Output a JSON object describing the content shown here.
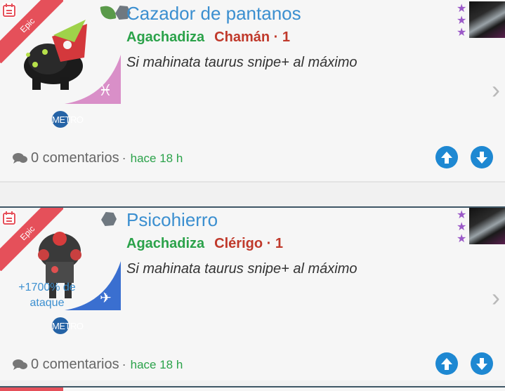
{
  "cards": [
    {
      "rarity": "Epic",
      "name": "Cazador de pantanos",
      "family": "Agachadiza",
      "role": "Chamán · 1",
      "description": "Si mahinata taurus snipe+ al máximo",
      "tribe_symbol": "♓",
      "bonus_line1": "",
      "bonus_line2": "",
      "metro_label": "METRO",
      "stars": [
        "★",
        "★",
        "★"
      ],
      "comments": "0 comentarios",
      "separator": "·",
      "time": "hace 18 h",
      "triangle_color": "#d98fc8"
    },
    {
      "rarity": "Epic",
      "name": "Psicohierro",
      "family": "Agachadiza",
      "role": "Clérigo · 1",
      "description": "Si mahinata taurus snipe+ al máximo",
      "tribe_symbol": "✈",
      "bonus_line1": "+1700% de",
      "bonus_line2": "ataque",
      "metro_label": "METRO",
      "stars": [
        "★",
        "★",
        "★"
      ],
      "comments": "0 comentarios",
      "separator": "·",
      "time": "hace 18 h",
      "triangle_color": "#3a6fd0"
    }
  ],
  "colors": {
    "title": "#3b8fd0",
    "family": "#2ba24a",
    "role": "#c0392b",
    "ribbon": "#e5505a",
    "vote": "#1e88d2",
    "stars": "#9b59c8"
  },
  "icons": {
    "calendar": "calendar-icon",
    "chevron": "chevron-right-icon",
    "upvote": "arrow-up-icon",
    "downvote": "arrow-down-icon",
    "comment": "speech-bubble-icon"
  },
  "chevron_glyph": "›"
}
